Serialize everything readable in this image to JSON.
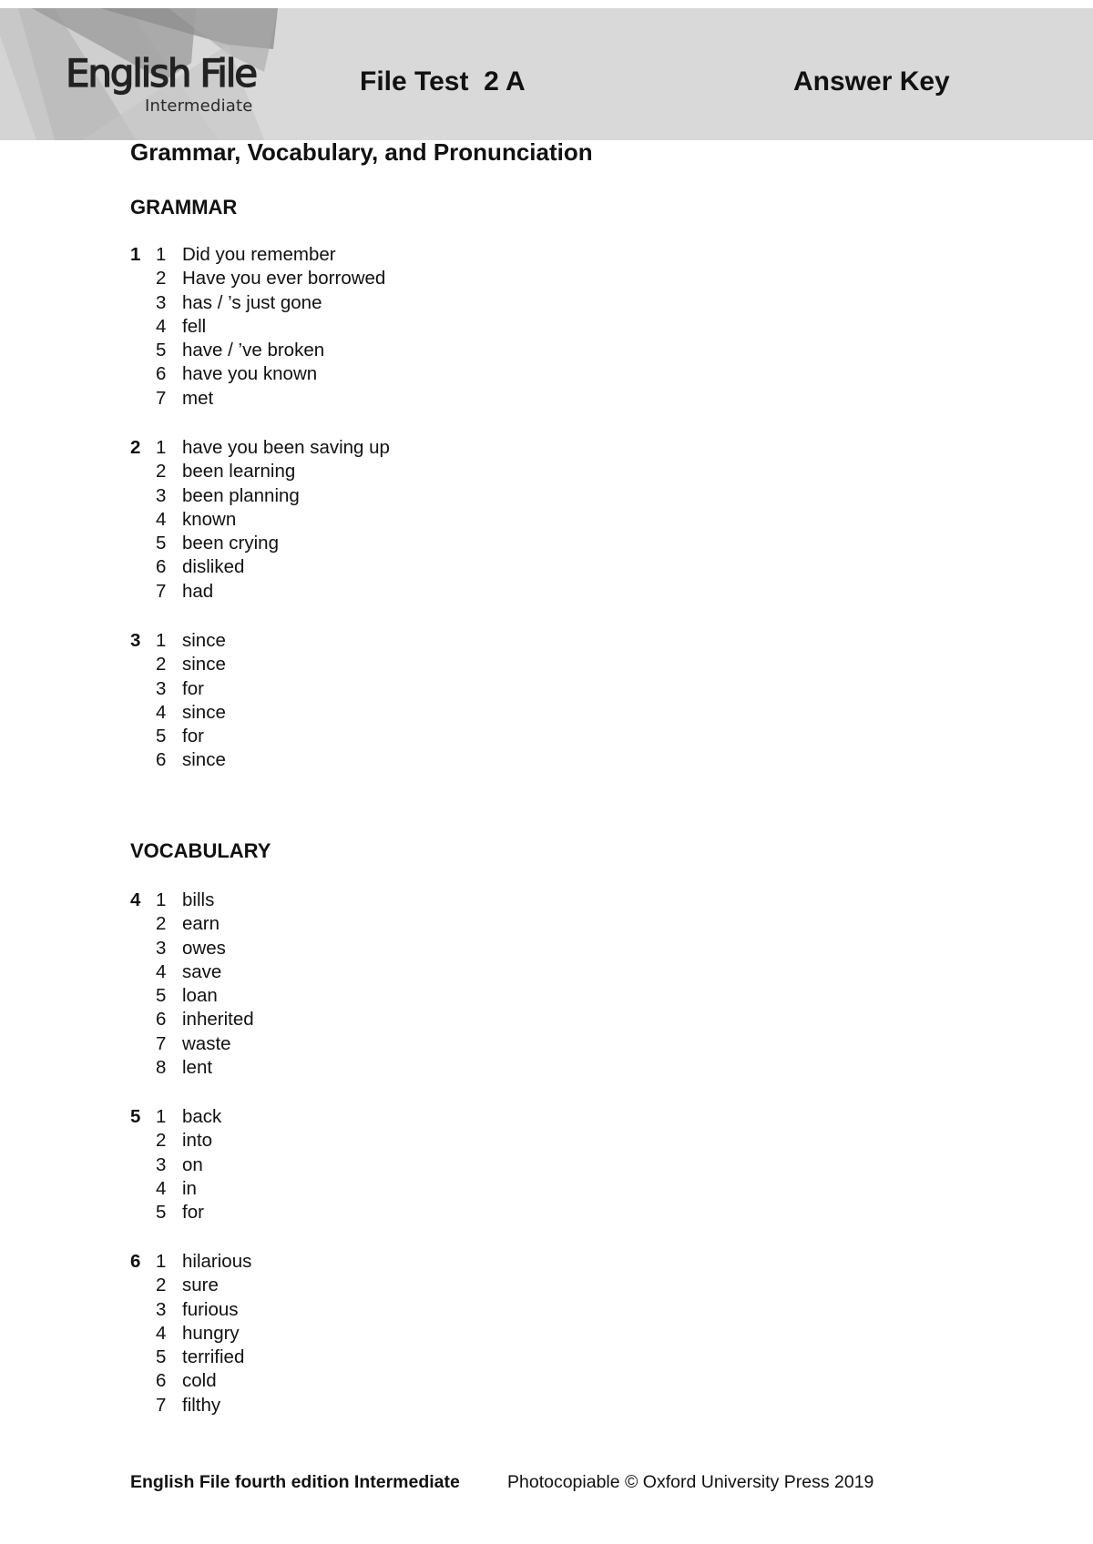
{
  "header": {
    "logo_title": "English File",
    "logo_subtitle": "Intermediate",
    "test_title": "File Test  2 A",
    "doc_type": "Answer Key",
    "band_color": "#d9d9d9"
  },
  "page_title": "Grammar, Vocabulary, and Pronunciation",
  "sections": [
    {
      "heading": "GRAMMAR",
      "exercises": [
        {
          "number": "1",
          "items": [
            {
              "n": "1",
              "answer": "Did you remember"
            },
            {
              "n": "2",
              "answer": "Have you ever borrowed"
            },
            {
              "n": "3",
              "answer": "has / ’s just gone"
            },
            {
              "n": "4",
              "answer": "fell"
            },
            {
              "n": "5",
              "answer": "have / ’ve broken"
            },
            {
              "n": "6",
              "answer": "have you known"
            },
            {
              "n": "7",
              "answer": "met"
            }
          ]
        },
        {
          "number": "2",
          "items": [
            {
              "n": "1",
              "answer": "have you been saving up"
            },
            {
              "n": "2",
              "answer": "been learning"
            },
            {
              "n": "3",
              "answer": "been planning"
            },
            {
              "n": "4",
              "answer": "known"
            },
            {
              "n": "5",
              "answer": "been crying"
            },
            {
              "n": "6",
              "answer": "disliked"
            },
            {
              "n": "7",
              "answer": "had"
            }
          ]
        },
        {
          "number": "3",
          "items": [
            {
              "n": "1",
              "answer": "since"
            },
            {
              "n": "2",
              "answer": "since"
            },
            {
              "n": "3",
              "answer": "for"
            },
            {
              "n": "4",
              "answer": "since"
            },
            {
              "n": "5",
              "answer": "for"
            },
            {
              "n": "6",
              "answer": "since"
            }
          ]
        }
      ]
    },
    {
      "heading": "VOCABULARY",
      "exercises": [
        {
          "number": "4",
          "items": [
            {
              "n": "1",
              "answer": "bills"
            },
            {
              "n": "2",
              "answer": "earn"
            },
            {
              "n": "3",
              "answer": "owes"
            },
            {
              "n": "4",
              "answer": "save"
            },
            {
              "n": "5",
              "answer": "loan"
            },
            {
              "n": "6",
              "answer": "inherited"
            },
            {
              "n": "7",
              "answer": "waste"
            },
            {
              "n": "8",
              "answer": "lent"
            }
          ]
        },
        {
          "number": "5",
          "items": [
            {
              "n": "1",
              "answer": "back"
            },
            {
              "n": "2",
              "answer": "into"
            },
            {
              "n": "3",
              "answer": "on"
            },
            {
              "n": "4",
              "answer": "in"
            },
            {
              "n": "5",
              "answer": "for"
            }
          ]
        },
        {
          "number": "6",
          "items": [
            {
              "n": "1",
              "answer": "hilarious"
            },
            {
              "n": "2",
              "answer": "sure"
            },
            {
              "n": "3",
              "answer": "furious"
            },
            {
              "n": "4",
              "answer": "hungry"
            },
            {
              "n": "5",
              "answer": "terrified"
            },
            {
              "n": "6",
              "answer": "cold"
            },
            {
              "n": "7",
              "answer": "filthy"
            }
          ]
        }
      ]
    }
  ],
  "footer": {
    "left": "English File fourth edition Intermediate",
    "right": "Photocopiable © Oxford University Press 2019"
  }
}
